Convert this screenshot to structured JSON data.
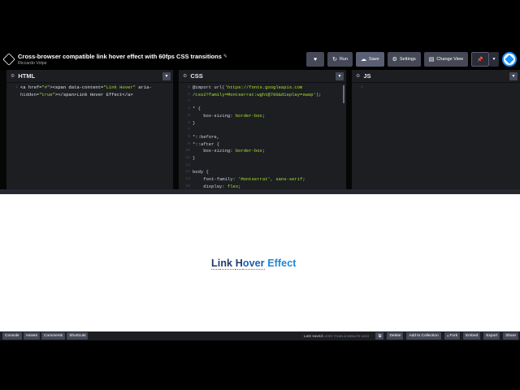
{
  "header": {
    "title": "Cross-browser compatible link hover effect with 60fps CSS transitions",
    "author": "Riccardo Volpe",
    "buttons": {
      "run": "Run",
      "save": "Save",
      "settings": "Settings",
      "change_view": "Change View"
    },
    "icons": [
      "codepen-logo-icon",
      "pencil-icon",
      "heart-icon",
      "refresh-icon",
      "cloud-icon",
      "gear-icon",
      "layout-icon",
      "pin-icon",
      "chevron-down-icon",
      "avatar"
    ]
  },
  "panels": {
    "html": {
      "name": "HTML"
    },
    "css": {
      "name": "CSS"
    },
    "js": {
      "name": "JS"
    }
  },
  "html_code": {
    "line_numbers": [
      "1",
      "2"
    ],
    "l1": {
      "t1": "<a href=",
      "s1": "\"#\"",
      "t2": "><span data-content=",
      "s2": "\"Link Hover\"",
      "t3": " aria-"
    },
    "l2": {
      "t1": "hidden=",
      "s1": "\"true\"",
      "t2": "></span>Link Hover Effect</a>"
    }
  },
  "css_code": {
    "line_numbers": [
      "1",
      "2",
      "3",
      "4",
      "5",
      "6",
      "7",
      "8",
      "9",
      "10",
      "11",
      "12",
      "13",
      "14",
      "15"
    ],
    "lines": [
      {
        "a": "@import url(",
        "b": "'https://fonts.googleapis.com",
        "c": ""
      },
      {
        "a": "",
        "b": "/css2?family=Montserrat:wght@700&display=swap'",
        "c": ");"
      },
      {
        "a": "",
        "b": "",
        "c": ""
      },
      {
        "a": "* {",
        "b": "",
        "c": ""
      },
      {
        "a": "    box-sizing: ",
        "b": "border-box",
        "c": ";"
      },
      {
        "a": "}",
        "b": "",
        "c": ""
      },
      {
        "a": "",
        "b": "",
        "c": ""
      },
      {
        "a": "*::before,",
        "b": "",
        "c": ""
      },
      {
        "a": "*::after {",
        "b": "",
        "c": ""
      },
      {
        "a": "    box-sizing: ",
        "b": "border-box",
        "c": ";"
      },
      {
        "a": "}",
        "b": "",
        "c": ""
      },
      {
        "a": "",
        "b": "",
        "c": ""
      },
      {
        "a": "body {",
        "b": "",
        "c": ""
      },
      {
        "a": "    font-family: ",
        "b": "'Montserrat', sans-serif",
        "c": ";"
      },
      {
        "a": "    display: ",
        "b": "flex",
        "c": ";"
      }
    ]
  },
  "js_code": {
    "line_numbers": [
      "1"
    ]
  },
  "preview": {
    "first_letters": "Li",
    "rest_word": "nk ",
    "hover_first": "H",
    "hover_rest": "over",
    "effect": " Effect"
  },
  "footer": {
    "left_buttons": [
      "Console",
      "Assets",
      "Comments",
      "Shortcuts"
    ],
    "last_saved_label": "Last saved",
    "last_saved_when": "LESS THAN A MINUTE AGO",
    "right_buttons": [
      "Delete",
      "Add to Collection",
      "Fork",
      "Embed",
      "Export",
      "Share"
    ]
  },
  "colors": {
    "accent": "#1a5fb4",
    "editor_bg": "#1d1e22",
    "button_bg": "#444857",
    "string_green": "#a6e22e"
  }
}
